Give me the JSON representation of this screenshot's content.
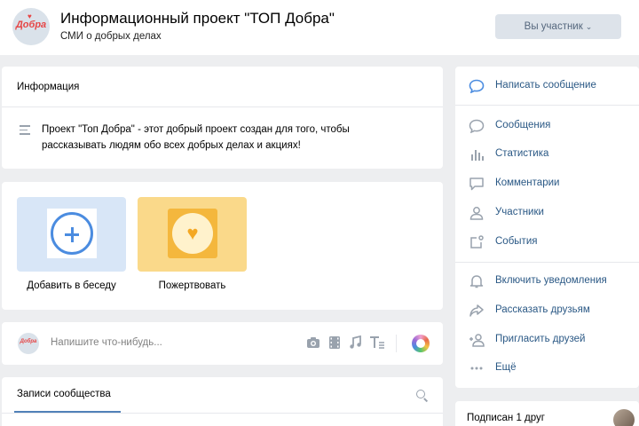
{
  "header": {
    "logo_text": "Добра",
    "title": "Информационный проект \"ТОП Добра\"",
    "subtitle": "СМИ о добрых делах",
    "member_button": "Вы участник",
    "member_chevron": "⌄"
  },
  "info": {
    "title": "Информация",
    "description": "Проект \"Топ Добра\" - этот добрый проект создан для того, чтобы рассказывать людям обо всех добрых делах и акциях!"
  },
  "actions": [
    {
      "label": "Добавить в беседу",
      "icon": "plus-circle-icon"
    },
    {
      "label": "Пожертвовать",
      "icon": "heart-icon"
    }
  ],
  "composer": {
    "placeholder": "Напишите что-нибудь...",
    "tools": [
      "camera-icon",
      "video-icon",
      "music-icon",
      "text-icon",
      "palette-icon"
    ]
  },
  "wall": {
    "tab": "Записи сообщества"
  },
  "menu": {
    "items": [
      {
        "label": "Написать сообщение",
        "icon": "message-icon"
      },
      {
        "label": "Сообщения",
        "icon": "messages-icon"
      },
      {
        "label": "Статистика",
        "icon": "stats-icon"
      },
      {
        "label": "Комментарии",
        "icon": "comments-icon"
      },
      {
        "label": "Участники",
        "icon": "user-icon"
      },
      {
        "label": "События",
        "icon": "events-icon"
      },
      {
        "label": "Включить уведомления",
        "icon": "bell-icon"
      },
      {
        "label": "Рассказать друзьям",
        "icon": "share-icon"
      },
      {
        "label": "Пригласить друзей",
        "icon": "add-user-icon"
      },
      {
        "label": "Ещё",
        "icon": "more-icon"
      }
    ]
  },
  "friends": {
    "label": "Подписан 1 друг"
  },
  "colors": {
    "accent": "#5181b8",
    "link": "#2a5885",
    "icon": "#99a2ad",
    "background": "#edeef0"
  }
}
